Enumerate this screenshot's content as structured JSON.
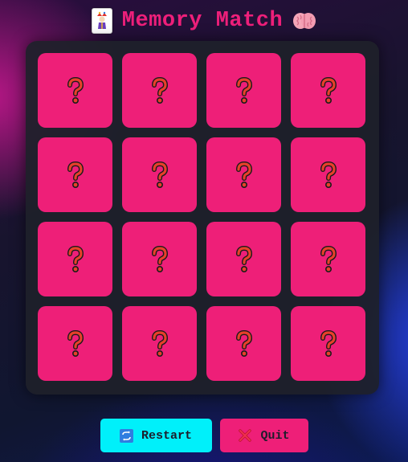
{
  "header": {
    "title": "Memory Match",
    "left_icon": "joker-card-icon",
    "right_icon": "brain-icon"
  },
  "board": {
    "rows": 4,
    "columns": 4,
    "cards": [
      {
        "face": "?",
        "state": "hidden"
      },
      {
        "face": "?",
        "state": "hidden"
      },
      {
        "face": "?",
        "state": "hidden"
      },
      {
        "face": "?",
        "state": "hidden"
      },
      {
        "face": "?",
        "state": "hidden"
      },
      {
        "face": "?",
        "state": "hidden"
      },
      {
        "face": "?",
        "state": "hidden"
      },
      {
        "face": "?",
        "state": "hidden"
      },
      {
        "face": "?",
        "state": "hidden"
      },
      {
        "face": "?",
        "state": "hidden"
      },
      {
        "face": "?",
        "state": "hidden"
      },
      {
        "face": "?",
        "state": "hidden"
      },
      {
        "face": "?",
        "state": "hidden"
      },
      {
        "face": "?",
        "state": "hidden"
      },
      {
        "face": "?",
        "state": "hidden"
      },
      {
        "face": "?",
        "state": "hidden"
      }
    ]
  },
  "controls": {
    "restart_label": "Restart",
    "restart_icon": "restart-icon",
    "quit_label": "Quit",
    "quit_icon": "cross-mark-icon"
  },
  "colors": {
    "title": "#ee1f7a",
    "card": "#ee1f78",
    "question_mark": "#e8402a",
    "board_panel": "#1e202a",
    "restart_button": "#00f0fa",
    "quit_button": "#ee1f78"
  }
}
